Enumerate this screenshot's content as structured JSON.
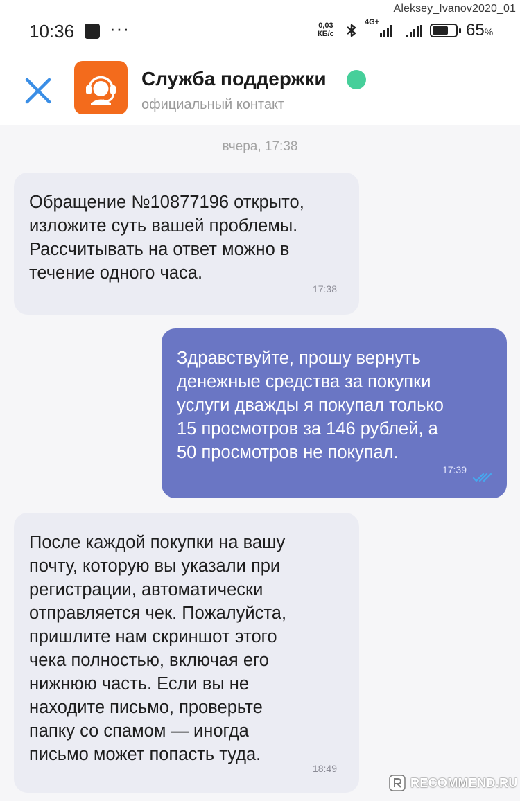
{
  "watermark_user": "Aleksey_Ivanov2020_01",
  "status_bar": {
    "time": "10:36",
    "dots": "···",
    "speed_value": "0,03",
    "speed_unit": "КБ/с",
    "network": "4G+",
    "battery_pct": "65",
    "battery_unit": "%"
  },
  "header": {
    "title": "Служба поддержки",
    "subtitle": "официальный контакт",
    "online_color": "#46cf9a",
    "avatar_color": "#f36b1c"
  },
  "chat": {
    "date_separator": "вчера, 17:38",
    "messages": [
      {
        "direction": "incoming",
        "text": "Обращение №10877196 открыто,\nизложите суть вашей проблемы.\nРассчитывать на ответ можно в\nтечение одного часа.",
        "time": "17:38"
      },
      {
        "direction": "outgoing",
        "text": "Здравствуйте, прошу вернуть\nденежные средства за покупки\nуслуги дважды я покупал только\n15 просмотров за 146 рублей, а\n50 просмотров не покупал.",
        "time": "17:39",
        "status_icon": "double-check-icon"
      },
      {
        "direction": "incoming",
        "text": "После каждой покупки на вашу\nпочту, которую вы указали при\nрегистрации, автоматически\nотправляется чек. Пожалуйста,\nпришлите нам скриншот этого\nчека полностью, включая его\nнижнюю часть. Если вы не\nнаходите письмо, проверьте\nпапку со спамом — иногда\nписьмо может попасть туда.",
        "time": "18:49"
      }
    ]
  },
  "footer_watermark": "RECOMMEND.RU",
  "colors": {
    "incoming_bubble": "#ebecf3",
    "outgoing_bubble": "#6a76c4",
    "close_icon": "#3a8ee6"
  }
}
